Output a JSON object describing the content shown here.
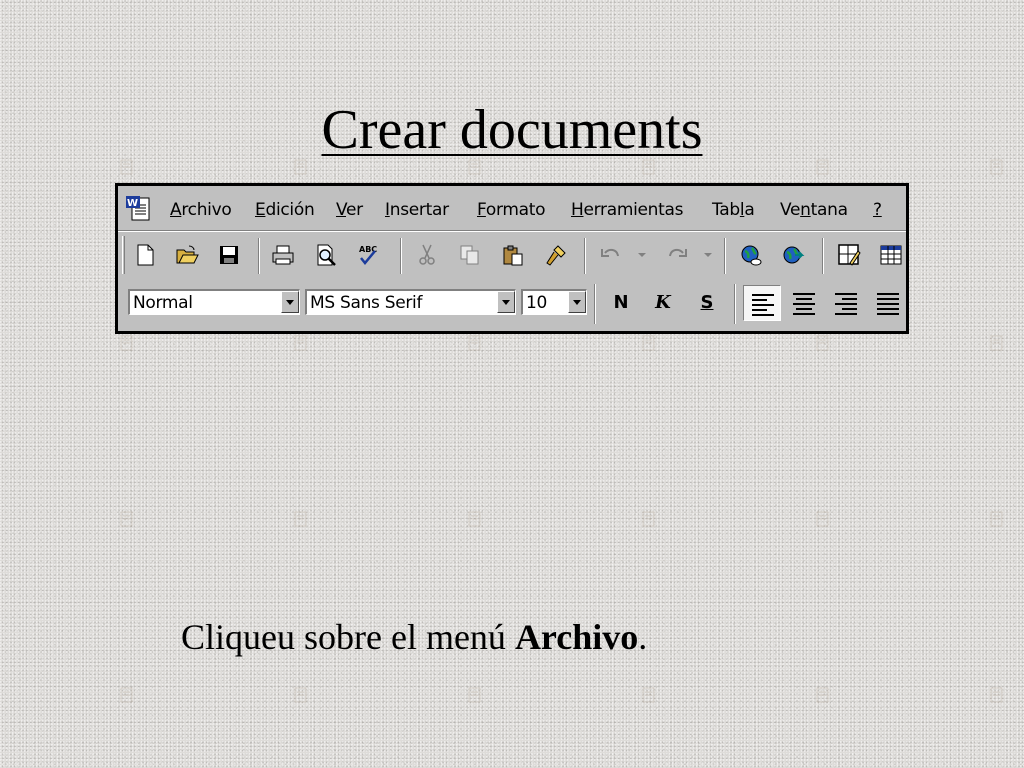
{
  "slide": {
    "title": "Crear documents",
    "instruction_prefix": "Cliqueu sobre el menú ",
    "instruction_emphasis": "Archivo",
    "instruction_suffix": "."
  },
  "app": {
    "icon": "word-document-icon",
    "menu": [
      {
        "pre": "",
        "mn": "A",
        "post": "rchivo"
      },
      {
        "pre": "",
        "mn": "E",
        "post": "dición"
      },
      {
        "pre": "",
        "mn": "V",
        "post": "er"
      },
      {
        "pre": "",
        "mn": "I",
        "post": "nsertar"
      },
      {
        "pre": "",
        "mn": "F",
        "post": "ormato"
      },
      {
        "pre": "",
        "mn": "H",
        "post": "erramientas"
      },
      {
        "pre": "Tab",
        "mn": "l",
        "post": "a"
      },
      {
        "pre": "Ve",
        "mn": "n",
        "post": "tana"
      },
      {
        "pre": "",
        "mn": "?",
        "post": ""
      }
    ],
    "standard_toolbar": [
      "new-document-icon",
      "open-folder-icon",
      "save-icon",
      "print-icon",
      "print-preview-icon",
      "spelling-check-icon",
      "cut-icon",
      "copy-icon",
      "paste-icon",
      "format-painter-icon",
      "undo-icon",
      "redo-icon",
      "insert-hyperlink-icon",
      "web-toolbar-icon",
      "tables-and-borders-icon",
      "insert-table-icon"
    ],
    "formatting_toolbar": {
      "style": "Normal",
      "font": "MS Sans Serif",
      "size": "10",
      "bold_label": "N",
      "italic_label": "K",
      "underline_label": "S",
      "alignment_active": "left"
    }
  }
}
